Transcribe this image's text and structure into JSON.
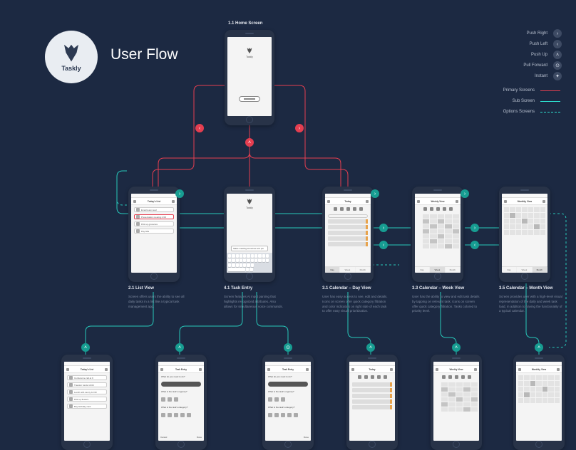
{
  "brand": "Taskly",
  "title": "User Flow",
  "legend": {
    "push_right": "Push Right",
    "push_left": "Push Left",
    "push_up": "Push Up",
    "pull_forward": "Pull Forward",
    "instant": "Instant",
    "primary_screens": "Primary Screens",
    "sub_screen": "Sub Screen",
    "options_screens": "Options Screens"
  },
  "screens": {
    "home": {
      "num": "1.1",
      "title": "Home Screen",
      "brand": "Taskly"
    },
    "list": {
      "num": "2.1",
      "title": "List View",
      "header": "Today's List",
      "tasks": [
        "Email team lead",
        "Presentation meeting 2:00",
        "Pick up groceries",
        "Pay bills"
      ],
      "desc": "Screen offers users the ability to see all daily tasks in a list like a typical task management app."
    },
    "entry": {
      "num": "4.1",
      "title": "Task Entry",
      "input": "Sales meeting tomorrow at 2 pm",
      "brand": "Taskly",
      "desc": "Screen features AI input parsing that highlights recognized attributes. Also allows for simultaneous voice commands."
    },
    "day": {
      "num": "3.1",
      "title": "Calendar – Day View",
      "header": "Today",
      "tabs": [
        "Day",
        "Week",
        "Month"
      ],
      "desc": "User has easy access to see, edit and details. Icons on screen offer quick category filtration and color indicators on right side of each task to offer easy visual prioritization."
    },
    "week": {
      "num": "3.3",
      "title": "Calendar – Week View",
      "header": "Weekly View",
      "tabs": [
        "Day",
        "Week",
        "Month"
      ],
      "desc": "User has the ability to view and edit task details by tapping on relevant task. Icons on screen offer quick category filtration. Tasks colored to priority level."
    },
    "month": {
      "num": "3.5",
      "title": "Calendar – Month View",
      "header": "Monthly View",
      "tabs": [
        "Day",
        "Week",
        "Month"
      ],
      "desc": "Screen provides user with a high-level visual representation of the daily and week task load, in addition to having the functionality of a typical calendar."
    },
    "list_sub": {
      "header": "Today's List",
      "tasks": [
        "Conference call at 9",
        "Transfer funds 10:00",
        "Lunch with Jenny 12:30",
        "Pick up flowers",
        "Buy birthday card"
      ]
    },
    "entry_sub": {
      "header": "Task Entry",
      "q1": "What do you need to do?",
      "q2": "What is the task's urgency?",
      "q3": "What is the task's category?",
      "cancel": "Cancel",
      "done": "Done"
    },
    "day_sub": {
      "header": "Today"
    },
    "week_sub": {
      "header": "Weekly View"
    },
    "month_sub": {
      "header": "Monthly View"
    }
  }
}
